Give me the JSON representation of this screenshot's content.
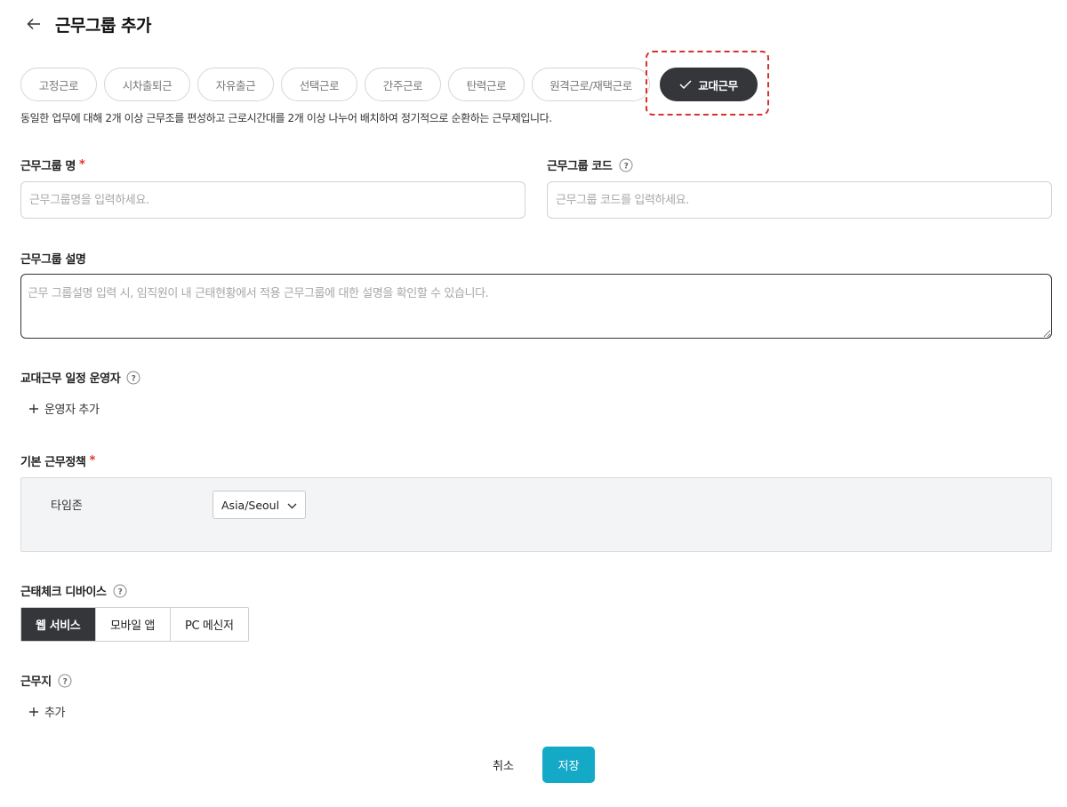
{
  "header": {
    "title": "근무그룹 추가",
    "back_icon": "arrow-left-icon"
  },
  "work_types": {
    "items": [
      {
        "label": "고정근로",
        "active": false
      },
      {
        "label": "시차출퇴근",
        "active": false
      },
      {
        "label": "자유출근",
        "active": false
      },
      {
        "label": "선택근로",
        "active": false
      },
      {
        "label": "간주근로",
        "active": false
      },
      {
        "label": "탄력근로",
        "active": false
      },
      {
        "label": "원격근로/재택근로",
        "active": false
      },
      {
        "label": "교대근무",
        "active": true
      }
    ],
    "selected_icon": "check-icon",
    "description": "동일한 업무에 대해 2개 이상 근무조를 편성하고 근로시간대를 2개 이상 나누어 배치하여 정기적으로 순환하는 근무제입니다."
  },
  "form": {
    "group_name": {
      "label": "근무그룹 명",
      "required_mark": "*",
      "placeholder": "근무그룹명을 입력하세요.",
      "value": ""
    },
    "group_code": {
      "label": "근무그룹 코드",
      "placeholder": "근무그룹 코드를 입력하세요.",
      "value": ""
    },
    "group_desc": {
      "label": "근무그룹 설명",
      "placeholder": "근무 그룹설명 입력 시, 임직원이 내 근태현황에서 적용 근무그룹에 대한 설명을 확인할 수 있습니다.",
      "value": ""
    },
    "shift_operator": {
      "label": "교대근무 일정 운영자",
      "add_label": "운영자 추가"
    },
    "base_policy": {
      "label": "기본 근무정책",
      "required_mark": "*",
      "timezone_label": "타임존",
      "timezone_value": "Asia/Seoul"
    },
    "check_device": {
      "label": "근태체크 디바이스",
      "options": [
        "웹 서비스",
        "모바일 앱",
        "PC 메신저"
      ],
      "selected": "웹 서비스"
    },
    "workplace": {
      "label": "근무지",
      "add_label": "추가"
    }
  },
  "footer": {
    "cancel_label": "취소",
    "save_label": "저장"
  },
  "colors": {
    "accent": "#13a9c7",
    "dark": "#34363a",
    "required": "#e0312f",
    "highlight_frame": "#d6312b"
  }
}
